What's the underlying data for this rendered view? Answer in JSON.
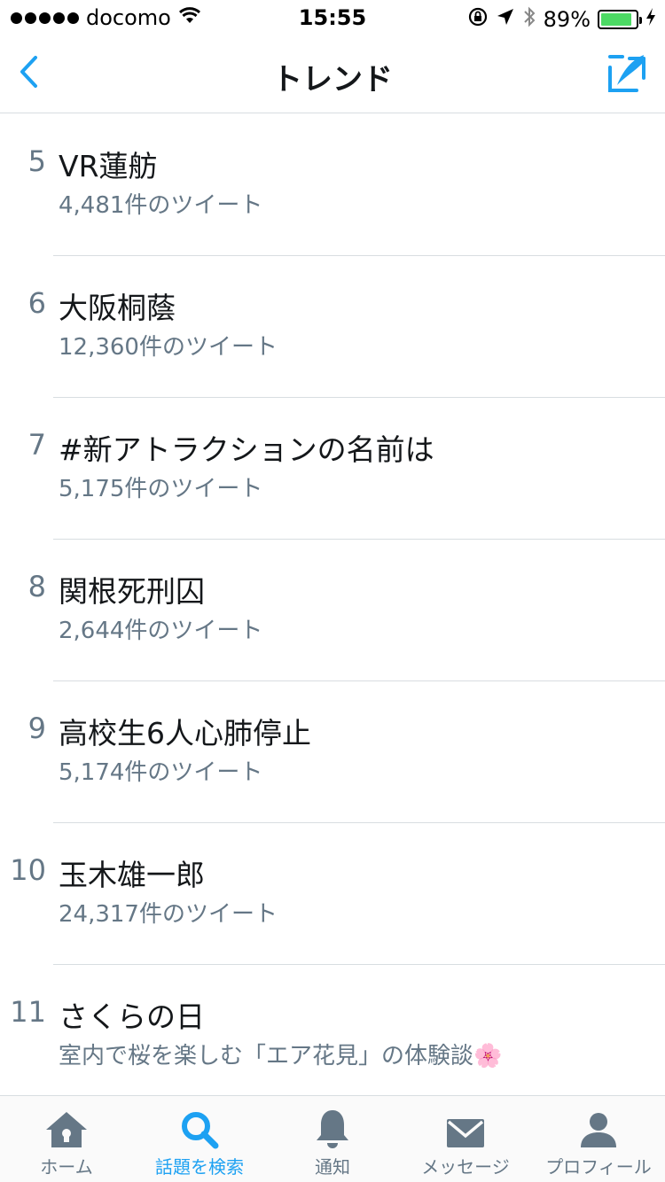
{
  "status_bar": {
    "carrier": "docomo",
    "time": "15:55",
    "battery_percent": "89%",
    "battery_level": 0.89,
    "icons": [
      "signal-dots",
      "wifi-icon",
      "rotation-lock-icon",
      "location-arrow-icon",
      "bluetooth-icon",
      "battery-icon",
      "charging-bolt-icon"
    ]
  },
  "nav": {
    "title": "トレンド",
    "back_icon": "chevron-left-icon",
    "compose_icon": "compose-quill-icon"
  },
  "trends": [
    {
      "rank": "5",
      "name": "VR蓮舫",
      "subtitle": "4,481件のツイート"
    },
    {
      "rank": "6",
      "name": "大阪桐蔭",
      "subtitle": "12,360件のツイート"
    },
    {
      "rank": "7",
      "name": "#新アトラクションの名前は",
      "subtitle": "5,175件のツイート"
    },
    {
      "rank": "8",
      "name": "関根死刑囚",
      "subtitle": "2,644件のツイート"
    },
    {
      "rank": "9",
      "name": "高校生6人心肺停止",
      "subtitle": "5,174件のツイート"
    },
    {
      "rank": "10",
      "name": "玉木雄一郎",
      "subtitle": "24,317件のツイート"
    },
    {
      "rank": "11",
      "name": "さくらの日",
      "subtitle": "室内で桜を楽しむ「エア花見」の体験談🌸"
    }
  ],
  "tabs": [
    {
      "label": "ホーム",
      "icon": "home-icon",
      "active": false
    },
    {
      "label": "話題を検索",
      "icon": "search-icon",
      "active": true
    },
    {
      "label": "通知",
      "icon": "bell-icon",
      "active": false
    },
    {
      "label": "メッセージ",
      "icon": "envelope-icon",
      "active": false
    },
    {
      "label": "プロフィール",
      "icon": "person-icon",
      "active": false
    }
  ],
  "colors": {
    "accent": "#1da1f2",
    "secondary_text": "#657786",
    "inactive_icon": "#657786",
    "battery": "#4cd964"
  }
}
